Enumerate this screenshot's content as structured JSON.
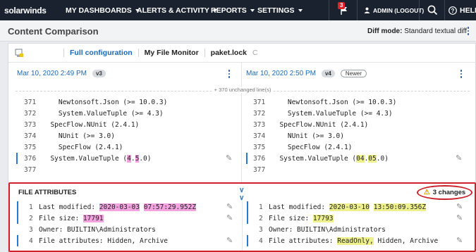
{
  "nav": {
    "logo": "solarwinds",
    "menus": [
      "MY DASHBOARDS",
      "ALERTS & ACTIVITY",
      "REPORTS",
      "SETTINGS"
    ],
    "notification_count": "3",
    "admin_label": "ADMIN (LOGOUT)",
    "help_label": "HELP"
  },
  "page": {
    "title": "Content Comparison",
    "diff_mode_label": "Diff mode:",
    "diff_mode_value": "Standard textual diff"
  },
  "breadcrumb": {
    "items": [
      "Full configuration",
      "My File Monitor",
      "paket.lock"
    ],
    "trailing": "C"
  },
  "left": {
    "date": "Mar 10, 2020 2:49 PM",
    "version": "v3"
  },
  "right": {
    "date": "Mar 10, 2020 2:50 PM",
    "version": "v4",
    "newer_label": "Newer"
  },
  "unchanged_label": "+ 370 unchanged line(s)",
  "code": {
    "line_numbers": [
      "371",
      "372",
      "373",
      "374",
      "375",
      "376",
      "377"
    ],
    "lines": [
      "    Newtonsoft.Json (>= 10.0.3)",
      "    System.ValueTuple (>= 4.3)",
      "  SpecFlow.NUnit (2.4.1)",
      "    NUnit (>= 3.0)",
      "    SpecFlow (2.4.1)",
      "  System.ValueTuple (",
      ""
    ],
    "line376_left": {
      "pre": "  System.ValueTuple (",
      "h1": "4",
      "mid1": ".",
      "h2": "5",
      "post": ".0)"
    },
    "line376_right": {
      "pre": "  System.ValueTuple (",
      "h1": "04",
      "mid1": ".",
      "h2": "05",
      "post": ".0)"
    }
  },
  "file_attributes": {
    "title": "FILE ATTRIBUTES",
    "changes_label": "3 changes",
    "left": {
      "modified_label": "Last modified: ",
      "modified_date": "2020-03-03",
      "modified_time": "07:57:29.952Z",
      "size_label": "File size: ",
      "size_value": "17791",
      "owner": "Owner: BUILTIN\\Administrators",
      "attributes": "File attributes: Hidden, Archive"
    },
    "right": {
      "modified_label": "Last modified: ",
      "modified_date": "2020-03-10",
      "modified_time": "13:50:09.356Z",
      "size_label": "File size: ",
      "size_value": "17793",
      "owner": "Owner: BUILTIN\\Administrators",
      "attributes_label": "File attributes: ",
      "attributes_added": "ReadOnly,",
      "attributes_rest": " Hidden, Archive"
    }
  },
  "colors": {
    "nav_bg": "#1a2230",
    "link": "#1b6ab8",
    "removed_highlight": "#f3a3df",
    "added_highlight": "#eef08e",
    "change_bar": "#2a79d0",
    "annotation_red": "#d0222a"
  }
}
